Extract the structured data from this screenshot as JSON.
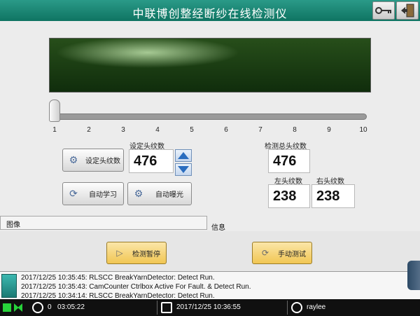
{
  "app": {
    "title": "中联博创整经断纱在线检测仪"
  },
  "slider": {
    "ticks": [
      "1",
      "2",
      "3",
      "4",
      "5",
      "6",
      "7",
      "8",
      "9",
      "10"
    ],
    "value": 1
  },
  "controls": {
    "set_heads_button": "设定头纹数",
    "set_heads_caption": "设定头纹数",
    "set_heads_value": "476",
    "auto_learn_button": "自动学习",
    "auto_exposure_button": "自动曝光",
    "total_heads_caption": "检测总头纹数",
    "total_heads_value": "476",
    "left_heads_caption": "左头纹数",
    "left_heads_value": "238",
    "right_heads_caption": "右头纹数",
    "right_heads_value": "238"
  },
  "tabs": {
    "image": "图像",
    "info": "信息"
  },
  "actions": {
    "pause_button": "检测暂停",
    "manual_test_button": "手动测试"
  },
  "log": {
    "lines": [
      "2017/12/25 10:35:45: RLSCC BreakYarnDetector: Detect Run.",
      "2017/12/25 10:35:43: CamCounter Ctrlbox Active For Fault. & Detect Run.",
      "2017/12/25 10:34:14: RLSCC BreakYarnDetector: Detect Run."
    ]
  },
  "status": {
    "counter": "0",
    "elapsed": "03:05:22",
    "datetime": "2017/12/25 10:36:55",
    "user": "raylee"
  },
  "colors": {
    "titlebar": "#0f7462",
    "accent_yellow": "#f1c653",
    "indicator_green": "#27d23a"
  }
}
